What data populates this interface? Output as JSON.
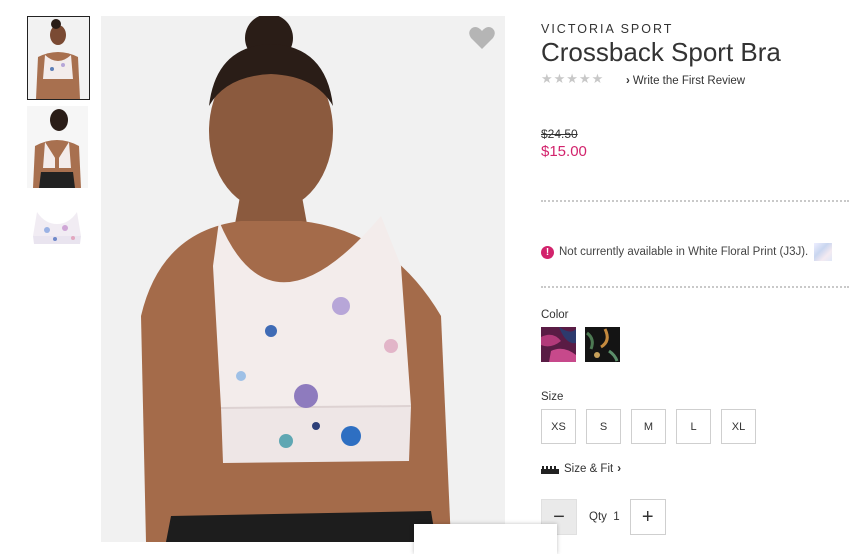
{
  "product": {
    "brand": "VICTORIA SPORT",
    "title": "Crossback Sport Bra",
    "rating_stars": "★★★★★",
    "review_link": "Write the First Review",
    "original_price": "$24.50",
    "sale_price": "$15.00",
    "availability_message": "Not currently available in White Floral Print (J3J)."
  },
  "options": {
    "color_label": "Color",
    "size_label": "Size",
    "sizes": [
      "XS",
      "S",
      "M",
      "L",
      "XL"
    ],
    "size_fit_link": "Size & Fit",
    "qty_label": "Qty",
    "qty_value": "1",
    "qty_minus": "−",
    "qty_plus": "+"
  },
  "icons": {
    "favorite": "heart-icon",
    "alert": "alert-circle-icon",
    "ruler": "ruler-icon",
    "chevron": "chevron-right-icon"
  },
  "colors": {
    "sale": "#d2236c",
    "alert": "#d2236c",
    "heart": "#b5b5b5"
  }
}
